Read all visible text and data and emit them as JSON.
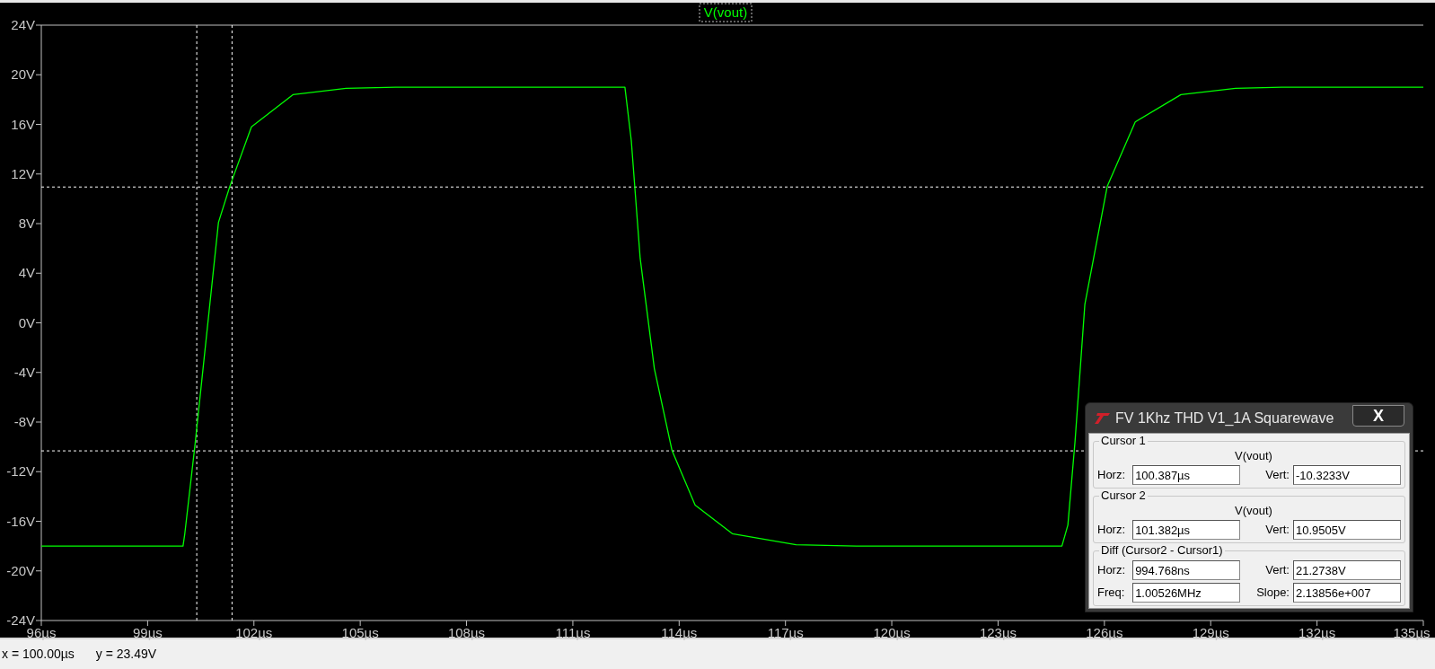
{
  "plot": {
    "chart_data": {
      "type": "line",
      "x": [
        96,
        100.0,
        100.05,
        100.33,
        101.0,
        101.32,
        101.93,
        103.1,
        104.6,
        106,
        112.47,
        112.65,
        112.9,
        113.3,
        113.8,
        114.45,
        115.5,
        117.3,
        119,
        124.8,
        124.97,
        125.17,
        125.45,
        126.08,
        126.87,
        128.16,
        129.7,
        131,
        135
      ],
      "series": [
        {
          "name": "V(vout)",
          "color": "#00ff00",
          "values": [
            -18,
            -18,
            -17,
            -10,
            8.1,
            11,
            15.8,
            18.4,
            18.9,
            19,
            19,
            14.7,
            5.2,
            -3.7,
            -10.3,
            -14.7,
            -17,
            -17.9,
            -18,
            -18,
            -16.3,
            -9.6,
            1.5,
            11,
            16.2,
            18.4,
            18.9,
            19,
            19
          ]
        }
      ],
      "xlim": [
        96,
        135
      ],
      "ylim": [
        -24,
        24
      ],
      "xticks": [
        {
          "value": 96,
          "label": "96µs"
        },
        {
          "value": 99,
          "label": "99µs"
        },
        {
          "value": 102,
          "label": "102µs"
        },
        {
          "value": 105,
          "label": "105µs"
        },
        {
          "value": 108,
          "label": "108µs"
        },
        {
          "value": 111,
          "label": "111µs"
        },
        {
          "value": 114,
          "label": "114µs"
        },
        {
          "value": 117,
          "label": "117µs"
        },
        {
          "value": 120,
          "label": "120µs"
        },
        {
          "value": 123,
          "label": "123µs"
        },
        {
          "value": 126,
          "label": "126µs"
        },
        {
          "value": 129,
          "label": "129µs"
        },
        {
          "value": 132,
          "label": "132µs"
        },
        {
          "value": 135,
          "label": "135µs"
        }
      ],
      "yticks": [
        {
          "value": 24,
          "label": "24V"
        },
        {
          "value": 20,
          "label": "20V"
        },
        {
          "value": 16,
          "label": "16V"
        },
        {
          "value": 12,
          "label": "12V"
        },
        {
          "value": 8,
          "label": "8V"
        },
        {
          "value": 4,
          "label": "4V"
        },
        {
          "value": 0,
          "label": "0V"
        },
        {
          "value": -4,
          "label": "-4V"
        },
        {
          "value": -8,
          "label": "-8V"
        },
        {
          "value": -12,
          "label": "-12V"
        },
        {
          "value": -16,
          "label": "-16V"
        },
        {
          "value": -20,
          "label": "-20V"
        },
        {
          "value": -24,
          "label": "-24V"
        }
      ],
      "ref_lines": [
        {
          "axis": "x",
          "value": 100.387
        },
        {
          "axis": "x",
          "value": 101.382
        },
        {
          "axis": "y",
          "value": -10.3233
        },
        {
          "axis": "y",
          "value": 10.9505
        }
      ]
    }
  },
  "cursor_dialog": {
    "title": "FV 1Khz THD V1_1A Squarewave",
    "close_button": "X",
    "groups": [
      {
        "title": "Cursor 1",
        "trace": "V(vout)",
        "rows": [
          [
            {
              "label": "Horz:",
              "value": "100.387µs"
            },
            {
              "label": "Vert:",
              "value": "-10.3233V"
            }
          ]
        ]
      },
      {
        "title": "Cursor 2",
        "trace": "V(vout)",
        "rows": [
          [
            {
              "label": "Horz:",
              "value": "101.382µs"
            },
            {
              "label": "Vert:",
              "value": "10.9505V"
            }
          ]
        ]
      },
      {
        "title": "Diff (Cursor2 - Cursor1)",
        "rows": [
          [
            {
              "label": "Horz:",
              "value": "994.768ns"
            },
            {
              "label": "Vert:",
              "value": "21.2738V"
            }
          ],
          [
            {
              "label": "Freq:",
              "value": "1.00526MHz"
            },
            {
              "label": "Slope:",
              "value": "2.13856e+007"
            }
          ]
        ]
      }
    ]
  },
  "status_bar": {
    "x": "x = 100.00µs",
    "y": "y = 23.49V"
  }
}
